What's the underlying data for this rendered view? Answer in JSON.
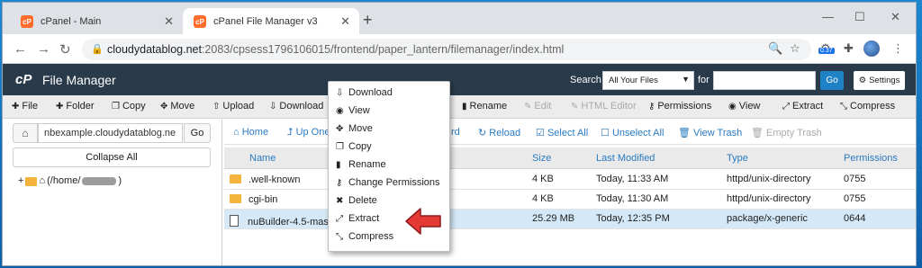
{
  "browser": {
    "tabs": [
      {
        "label": "cPanel - Main",
        "favicon": "cp"
      },
      {
        "label": "cPanel File Manager v3",
        "favicon": "cp",
        "active": true
      }
    ],
    "url_host": "cloudydatablog.net",
    "url_rest": ":2083/cpsess1796106015/frontend/paper_lantern/filemanager/index.html",
    "badge": "0.37"
  },
  "header": {
    "logo": "cP",
    "title": "File Manager",
    "search_label": "Search",
    "search_scope": "All Your Files",
    "for_label": "for",
    "go_label": "Go",
    "settings_label": "Settings"
  },
  "toolbar": {
    "items": [
      {
        "label": "File",
        "icon": "plus-icon"
      },
      {
        "label": "Folder",
        "icon": "plus-icon"
      },
      {
        "label": "Copy",
        "icon": "copy-icon"
      },
      {
        "label": "Move",
        "icon": "move-icon"
      },
      {
        "label": "Upload",
        "icon": "upload-icon"
      },
      {
        "label": "Download",
        "icon": "download-icon"
      },
      {
        "label": "Rename",
        "icon": "file-icon"
      },
      {
        "label": "Edit",
        "icon": "pencil-icon"
      },
      {
        "label": "HTML Editor",
        "icon": "html-icon"
      },
      {
        "label": "Permissions",
        "icon": "key-icon"
      },
      {
        "label": "View",
        "icon": "eye-icon"
      },
      {
        "label": "Extract",
        "icon": "expand-icon"
      },
      {
        "label": "Compress",
        "icon": "compress-icon"
      }
    ]
  },
  "left_panel": {
    "path_value": "nbexample.cloudydatablog.ne",
    "go_label": "Go",
    "collapse_label": "Collapse All",
    "tree_prefix": "(/home/",
    "tree_suffix": ")"
  },
  "navbar": {
    "home": "Home",
    "up": "Up One",
    "forward": "rd",
    "reload": "Reload",
    "select_all": "Select All",
    "unselect_all": "Unselect All",
    "view_trash": "View Trash",
    "empty_trash": "Empty Trash"
  },
  "table": {
    "headers": [
      "Name",
      "Size",
      "Last Modified",
      "Type",
      "Permissions"
    ],
    "rows": [
      {
        "name": ".well-known",
        "size": "4 KB",
        "modified": "Today, 11:33 AM",
        "type": "httpd/unix-directory",
        "perms": "0755",
        "kind": "folder"
      },
      {
        "name": "cgi-bin",
        "size": "4 KB",
        "modified": "Today, 11:30 AM",
        "type": "httpd/unix-directory",
        "perms": "0755",
        "kind": "folder"
      },
      {
        "name": "nuBuilder-4.5-maste",
        "size": "25.29 MB",
        "modified": "Today, 12:35 PM",
        "type": "package/x-generic",
        "perms": "0644",
        "kind": "file"
      }
    ]
  },
  "context_menu": {
    "items": [
      "Download",
      "View",
      "Move",
      "Copy",
      "Rename",
      "Change Permissions",
      "Delete",
      "Extract",
      "Compress"
    ]
  },
  "colors": {
    "header_bg": "#293a4a",
    "accent": "#1f82c7",
    "arrow": "#e53935"
  }
}
